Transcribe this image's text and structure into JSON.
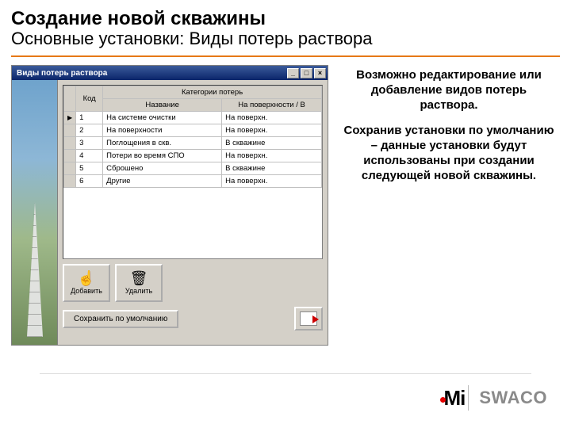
{
  "title": {
    "line1": "Создание новой скважины",
    "line2": "Основные установки: Виды потерь раствора"
  },
  "explain": {
    "p1": "Возможно редактирование или добавление видов потерь раствора.",
    "p2": "Сохранив установки по умолчанию – данные установки будут использованы при создании следующей новой скважины."
  },
  "app": {
    "window_title": "Виды потерь раствора",
    "grid": {
      "group_header": "Категории потерь",
      "headers": {
        "code": "Код",
        "name": "Название",
        "where": "На поверхности / В"
      },
      "rows": [
        {
          "code": "1",
          "name": "На системе очистки",
          "where": "На поверхн."
        },
        {
          "code": "2",
          "name": "На поверхности",
          "where": "На поверхн."
        },
        {
          "code": "3",
          "name": "Поглощения в скв.",
          "where": "В скважине"
        },
        {
          "code": "4",
          "name": "Потери во время СПО",
          "where": "На поверхн."
        },
        {
          "code": "5",
          "name": "Сброшено",
          "where": "В скважине"
        },
        {
          "code": "6",
          "name": "Другие",
          "where": "На поверхн."
        }
      ]
    },
    "buttons": {
      "add": "Добавить",
      "delete": "Удалить",
      "save_default": "Сохранить по умолчанию"
    }
  },
  "logo": {
    "mi": "Mi",
    "swaco": "SWACO"
  }
}
